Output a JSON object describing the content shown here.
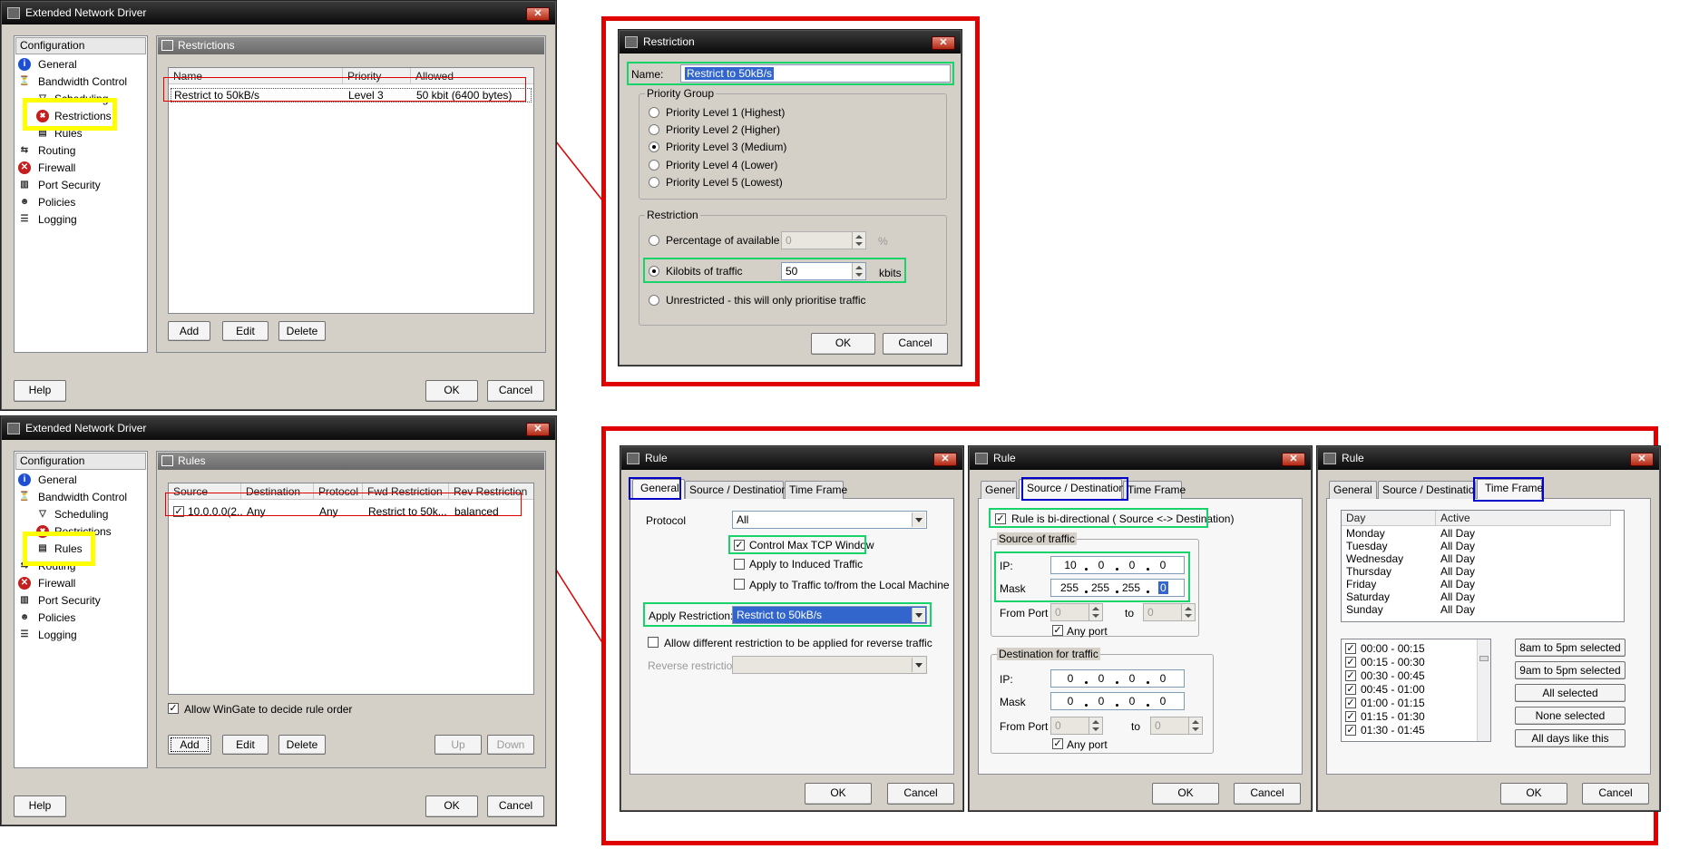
{
  "colors": {
    "highlight_red": "#e00000",
    "highlight_yellow": "#ffff00",
    "highlight_green": "#16d36a",
    "highlight_blue": "#0000c8",
    "selection": "#3366cc",
    "title_bar": "#0a0a0a"
  },
  "win1": {
    "title": "Extended Network Driver",
    "tree_header": "Configuration",
    "tree": [
      {
        "label": "General",
        "icon": "info-icon"
      },
      {
        "label": "Bandwidth Control",
        "icon": "filter-icon"
      },
      {
        "label": "Scheduling",
        "icon": "filter-icon"
      },
      {
        "label": "Restrictions",
        "icon": "restriction-icon"
      },
      {
        "label": "Rules",
        "icon": "rules-icon"
      },
      {
        "label": "Routing",
        "icon": "routing-icon"
      },
      {
        "label": "Firewall",
        "icon": "firewall-icon"
      },
      {
        "label": "Port Security",
        "icon": "port-icon"
      },
      {
        "label": "Policies",
        "icon": "policy-icon"
      },
      {
        "label": "Logging",
        "icon": "log-icon"
      }
    ],
    "section_title": "Restrictions",
    "columns": [
      "Name",
      "Priority",
      "Allowed"
    ],
    "rows": [
      {
        "name": "Restrict to 50kB/s",
        "priority": "Level 3",
        "allowed": "50 kbit (6400 bytes)"
      }
    ],
    "buttons": {
      "add": "Add",
      "edit": "Edit",
      "delete": "Delete",
      "help": "Help",
      "ok": "OK",
      "cancel": "Cancel"
    }
  },
  "win2": {
    "title": "Extended Network Driver",
    "tree_header": "Configuration",
    "tree": [
      {
        "label": "General"
      },
      {
        "label": "Bandwidth Control"
      },
      {
        "label": "Scheduling"
      },
      {
        "label": "Restrictions"
      },
      {
        "label": "Rules"
      },
      {
        "label": "Routing"
      },
      {
        "label": "Firewall"
      },
      {
        "label": "Port Security"
      },
      {
        "label": "Policies"
      },
      {
        "label": "Logging"
      }
    ],
    "section_title": "Rules",
    "columns": [
      "Source",
      "Destination",
      "Protocol",
      "Fwd Restriction",
      "Rev Restriction"
    ],
    "rows": [
      {
        "source": "10.0.0.0(2...",
        "destination": "Any",
        "protocol": "Any",
        "fwd": "Restrict to 50k...",
        "rev": "balanced",
        "checked": true
      }
    ],
    "allow_wingate": "Allow WinGate to decide rule order",
    "buttons": {
      "add": "Add",
      "edit": "Edit",
      "delete": "Delete",
      "up": "Up",
      "down": "Down",
      "help": "Help",
      "ok": "OK",
      "cancel": "Cancel"
    }
  },
  "restriction": {
    "title": "Restriction",
    "name_label": "Name:",
    "name_value": "Restrict to 50kB/s",
    "priority_group": "Priority Group",
    "levels": [
      "Priority Level 1 (Highest)",
      "Priority Level 2 (Higher)",
      "Priority Level 3 (Medium)",
      "Priority Level 4 (Lower)",
      "Priority Level 5 (Lowest)"
    ],
    "selected_level": 2,
    "restriction_group": "Restriction",
    "pct_label": "Percentage of available",
    "pct_value": "0",
    "pct_unit": "%",
    "kb_label": "Kilobits of traffic",
    "kb_value": "50",
    "kb_unit": "kbits",
    "unrestricted_label": "Unrestricted - this will only prioritise traffic",
    "ok": "OK",
    "cancel": "Cancel"
  },
  "rule_general": {
    "title": "Rule",
    "tabs": [
      "General",
      "Source / Destination",
      "Time Frame"
    ],
    "protocol_label": "Protocol",
    "protocol_value": "All",
    "chk_tcp": "Control Max TCP Window",
    "chk_induced": "Apply to Induced Traffic",
    "chk_local": "Apply to Traffic to/from the Local Machine",
    "apply_label": "Apply Restriction:",
    "apply_value": "Restrict to 50kB/s",
    "allow_diff": "Allow different restriction to be applied for reverse traffic",
    "reverse_label": "Reverse restriction:",
    "ok": "OK",
    "cancel": "Cancel"
  },
  "rule_srcdst": {
    "title": "Rule",
    "tabs": [
      "General",
      "Source / Destination",
      "Time Frame"
    ],
    "bidir": "Rule is bi-directional ( Source <-> Destination)",
    "src_group": "Source of traffic",
    "ip_label": "IP:",
    "mask_label": "Mask",
    "src_ip": [
      "10",
      "0",
      "0",
      "0"
    ],
    "src_mask": [
      "255",
      "255",
      "255",
      "0"
    ],
    "from_port": "From Port",
    "to": "to",
    "port_from": "0",
    "port_to": "0",
    "any_port": "Any port",
    "dst_group": "Destination for traffic",
    "dst_ip": [
      "0",
      "0",
      "0",
      "0"
    ],
    "dst_mask": [
      "0",
      "0",
      "0",
      "0"
    ],
    "ok": "OK",
    "cancel": "Cancel"
  },
  "rule_time": {
    "title": "Rule",
    "tabs": [
      "General",
      "Source / Destination",
      "Time Frame"
    ],
    "col_day": "Day",
    "col_active": "Active",
    "days": [
      [
        "Monday",
        "All Day"
      ],
      [
        "Tuesday",
        "All Day"
      ],
      [
        "Wednesday",
        "All Day"
      ],
      [
        "Thursday",
        "All Day"
      ],
      [
        "Friday",
        "All Day"
      ],
      [
        "Saturday",
        "All Day"
      ],
      [
        "Sunday",
        "All Day"
      ]
    ],
    "slots": [
      "00:00 - 00:15",
      "00:15 - 00:30",
      "00:30 - 00:45",
      "00:45 - 01:00",
      "01:00 - 01:15",
      "01:15 - 01:30",
      "01:30 - 01:45"
    ],
    "btns": [
      "8am to 5pm selected",
      "9am to 5pm selected",
      "All selected",
      "None selected",
      "All days like this"
    ],
    "ok": "OK",
    "cancel": "Cancel"
  }
}
